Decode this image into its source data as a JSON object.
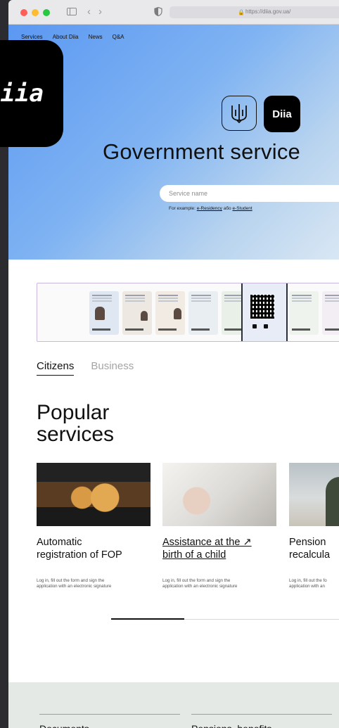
{
  "browser": {
    "url": "https://diia.gov.ua/",
    "back_glyph": "‹",
    "forward_glyph": "›"
  },
  "nav": {
    "items": [
      "Services",
      "About Diia",
      "News",
      "Q&A"
    ]
  },
  "app_icon": {
    "label": "iia"
  },
  "hero": {
    "emblem_label": "Diia",
    "title": "Government service",
    "search_placeholder": "Service name",
    "example_prefix": "For example:",
    "example_link_1": "e-Residency",
    "example_or": "або",
    "example_link_2": "e-Student"
  },
  "tabs": {
    "citizens": "Citizens",
    "business": "Business"
  },
  "popular": {
    "title_line1": "Popular",
    "title_line2": "services"
  },
  "cards": [
    {
      "title_line1": "Automatic",
      "title_line2": "registration of FOP",
      "desc_line1": "Log in, fill out the form and sign the",
      "desc_line2": "application with an electronic signature"
    },
    {
      "title_line1": "Assistance at the ↗",
      "title_line2": "birth of a child",
      "desc_line1": "Log in, fill out the form and sign the",
      "desc_line2": "application with an electronic signature"
    },
    {
      "title_line1": "Pension",
      "title_line2": "recalcula",
      "desc_line1": "Log in, fill out the fo",
      "desc_line2": "application with an"
    }
  ],
  "footer": {
    "col1": "Documents",
    "col2": "Pensions, benefits"
  },
  "colors": {
    "hero_gradient_start": "#5b98f2",
    "hero_gradient_end": "#dbe8f4",
    "brand_black": "#000000",
    "footer_band": "#e4e9e6"
  }
}
